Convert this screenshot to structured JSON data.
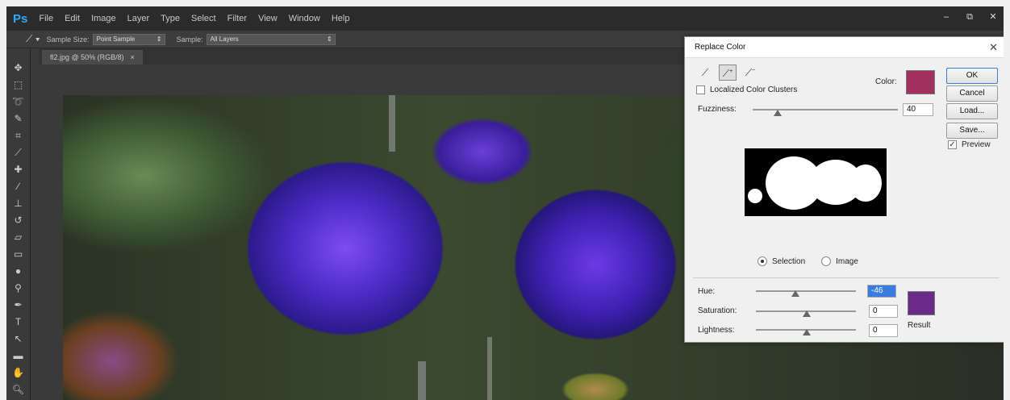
{
  "app": {
    "logo": "Ps",
    "menu": [
      "File",
      "Edit",
      "Image",
      "Layer",
      "Type",
      "Select",
      "Filter",
      "View",
      "Window",
      "Help"
    ],
    "window_controls": {
      "minimize": "–",
      "restore": "⧉",
      "close": "✕"
    }
  },
  "options_bar": {
    "sample_size_label": "Sample Size:",
    "sample_size_value": "Point Sample",
    "sample_label": "Sample:",
    "sample_value": "All Layers"
  },
  "document": {
    "tab_label": "fl2.jpg @ 50% (RGB/8)",
    "tab_close": "×"
  },
  "tools": [
    "move-icon",
    "marquee-icon",
    "lasso-icon",
    "quick-select-icon",
    "crop-icon",
    "eyedropper-icon",
    "healing-brush-icon",
    "brush-icon",
    "clone-stamp-icon",
    "history-brush-icon",
    "eraser-icon",
    "gradient-icon",
    "blur-icon",
    "dodge-icon",
    "pen-icon",
    "type-icon",
    "path-select-icon",
    "shape-icon",
    "hand-icon",
    "zoom-icon"
  ],
  "dialog": {
    "title": "Replace Color",
    "close": "✕",
    "localized_label": "Localized Color Clusters",
    "localized_checked": false,
    "color_label": "Color:",
    "color_swatch": "#a0305e",
    "fuzziness_label": "Fuzziness:",
    "fuzziness_value": "40",
    "selection_label": "Selection",
    "image_label": "Image",
    "selected_view": "Selection",
    "hue_label": "Hue:",
    "hue_value": "-46",
    "saturation_label": "Saturation:",
    "saturation_value": "0",
    "lightness_label": "Lightness:",
    "lightness_value": "0",
    "result_label": "Result",
    "result_swatch": "#6a2a8a",
    "buttons": {
      "ok": "OK",
      "cancel": "Cancel",
      "load": "Load...",
      "save": "Save..."
    },
    "preview_label": "Preview",
    "preview_checked": true
  }
}
